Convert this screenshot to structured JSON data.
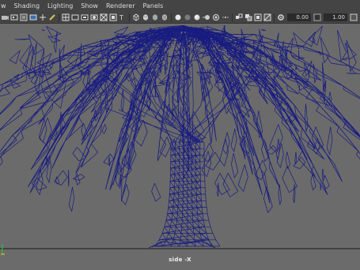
{
  "menu": {
    "items": [
      "w",
      "Shading",
      "Lighting",
      "Show",
      "Renderer",
      "Panels"
    ]
  },
  "toolbar": {
    "icons_left": [
      "select-camera-icon",
      "camera-attributes-icon",
      "bookmarks-icon",
      "image-plane-icon",
      "two-d-pan-icon",
      "grease-pencil-icon",
      "grid-icon",
      "film-gate-icon",
      "resolution-gate-icon",
      "gate-mask-icon",
      "field-chart-icon",
      "safe-action-icon",
      "safe-title-icon",
      "wireframe-icon",
      "smooth-shade-icon",
      "default-material-icon",
      "textured-icon",
      "use-lights-icon",
      "shadows-icon",
      "ambient-occlusion-icon",
      "motion-blur-icon",
      "anti-aliasing-icon",
      "depth-of-field-icon",
      "isolate-select-icon",
      "xray-icon",
      "xray-joints-icon",
      "xray-active-icon",
      "backface-culling-icon",
      "exposure-icon"
    ],
    "exposure_value": "0.00",
    "gamma_value": "1.00",
    "color_mgmt_icon": "color-management-icon"
  },
  "viewport": {
    "camera_label": "side -X",
    "wire_color": "#191c80",
    "background_color": "#6b6b6b",
    "grid_line_color": "#1a1a1a"
  }
}
